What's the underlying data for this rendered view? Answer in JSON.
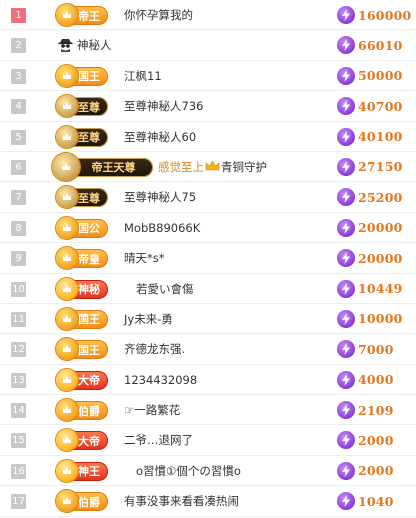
{
  "colors": {
    "rank_first_bg": "#f26d7d",
    "rank_bg": "#c8c8c8",
    "score_text": "#e6761e",
    "badge_gold": "#f08a13",
    "badge_dark": "#1e140a",
    "badge_red": "#e0301c",
    "bolt_purple": "#8a3bd8"
  },
  "rows": [
    {
      "rank": "1",
      "badge": "帝王",
      "badge_style": "gold",
      "name": "你怀孕算我的",
      "score": "160000"
    },
    {
      "rank": "2",
      "badge": "",
      "badge_style": "none",
      "icon": "spy-icon",
      "name": "神秘人",
      "score": "66010"
    },
    {
      "rank": "3",
      "badge": "国王",
      "badge_style": "gold",
      "name": "江枫11",
      "score": "50000"
    },
    {
      "rank": "4",
      "badge": "至尊",
      "badge_style": "dark",
      "name": "至尊神秘人736",
      "score": "40700"
    },
    {
      "rank": "5",
      "badge": "至尊",
      "badge_style": "dark",
      "name": "至尊神秘人60",
      "score": "40100"
    },
    {
      "rank": "6",
      "badge": "帝王天尊",
      "badge_style": "dark-wide",
      "name_prefix": "感觉至上",
      "name": "青铜守护",
      "score": "27150"
    },
    {
      "rank": "7",
      "badge": "至尊",
      "badge_style": "dark",
      "name": "至尊神秘人75",
      "score": "25200"
    },
    {
      "rank": "8",
      "badge": "国公",
      "badge_style": "gold",
      "name": "MobB89066K",
      "score": "20000"
    },
    {
      "rank": "9",
      "badge": "帝皇",
      "badge_style": "gold",
      "name": "晴天*s*",
      "score": "20000"
    },
    {
      "rank": "10",
      "badge": "神秘",
      "badge_style": "red",
      "name": "若愛い會傷",
      "score": "10449"
    },
    {
      "rank": "11",
      "badge": "国王",
      "badge_style": "gold",
      "name": "Jy未来-勇",
      "score": "10000"
    },
    {
      "rank": "12",
      "badge": "国王",
      "badge_style": "gold",
      "name": "齐德龙东强.",
      "score": "7000"
    },
    {
      "rank": "13",
      "badge": "大帝",
      "badge_style": "red",
      "name": "1234432098",
      "score": "4000"
    },
    {
      "rank": "14",
      "badge": "伯爵",
      "badge_style": "gold",
      "name": "☞一路繁花",
      "score": "2109"
    },
    {
      "rank": "15",
      "badge": "大帝",
      "badge_style": "red",
      "name": "二爷…退网了",
      "score": "2000"
    },
    {
      "rank": "16",
      "badge": "神王",
      "badge_style": "red",
      "name": "o習慣①個个の習慣o",
      "score": "2000"
    },
    {
      "rank": "17",
      "badge": "伯爵",
      "badge_style": "gold",
      "name": "有事没事来看看凑热闹",
      "score": "1040"
    }
  ]
}
